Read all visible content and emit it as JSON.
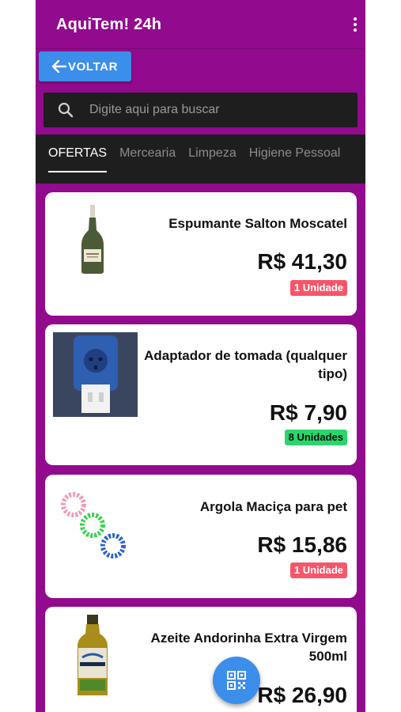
{
  "header": {
    "title": "AquiTem! 24h"
  },
  "back_button": {
    "label": "VOLTAR"
  },
  "search": {
    "placeholder": "Digite aqui para buscar"
  },
  "tabs": [
    {
      "label": "OFERTAS",
      "active": true
    },
    {
      "label": "Mercearia",
      "active": false
    },
    {
      "label": "Limpeza",
      "active": false
    },
    {
      "label": "Higiene Pessoal",
      "active": false
    }
  ],
  "products": [
    {
      "name": "Espumante Salton Moscatel",
      "price": "R$ 41,30",
      "stock": "1 Unidade",
      "stock_color": "#f7566a",
      "image": "sparkling-wine-bottle"
    },
    {
      "name": "Adaptador de tomada (qualquer tipo)",
      "price": "R$ 7,90",
      "stock": "8 Unidades",
      "stock_color": "#2bd56b",
      "image": "power-adapter"
    },
    {
      "name": "Argola Maciça para pet",
      "price": "R$ 15,86",
      "stock": "1 Unidade",
      "stock_color": "#f7566a",
      "image": "pet-rings"
    },
    {
      "name": "Azeite Andorinha Extra Virgem 500ml",
      "price": "R$ 26,90",
      "image": "olive-oil-bottle"
    }
  ],
  "colors": {
    "primary": "#920a8e",
    "accent": "#3b8eea",
    "dark": "#1e1e1e"
  },
  "fab": {
    "icon": "qr-code-icon"
  }
}
